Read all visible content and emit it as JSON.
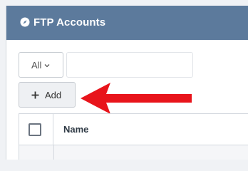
{
  "panel": {
    "title": "FTP Accounts",
    "icon": "compass-icon",
    "header_color": "#5c7a9c"
  },
  "toolbar": {
    "filter_value": "All",
    "search_value": "",
    "add_label": "Add"
  },
  "table": {
    "columns": [
      "",
      "Name"
    ]
  },
  "annotation": {
    "arrow_color": "#e8141b"
  }
}
